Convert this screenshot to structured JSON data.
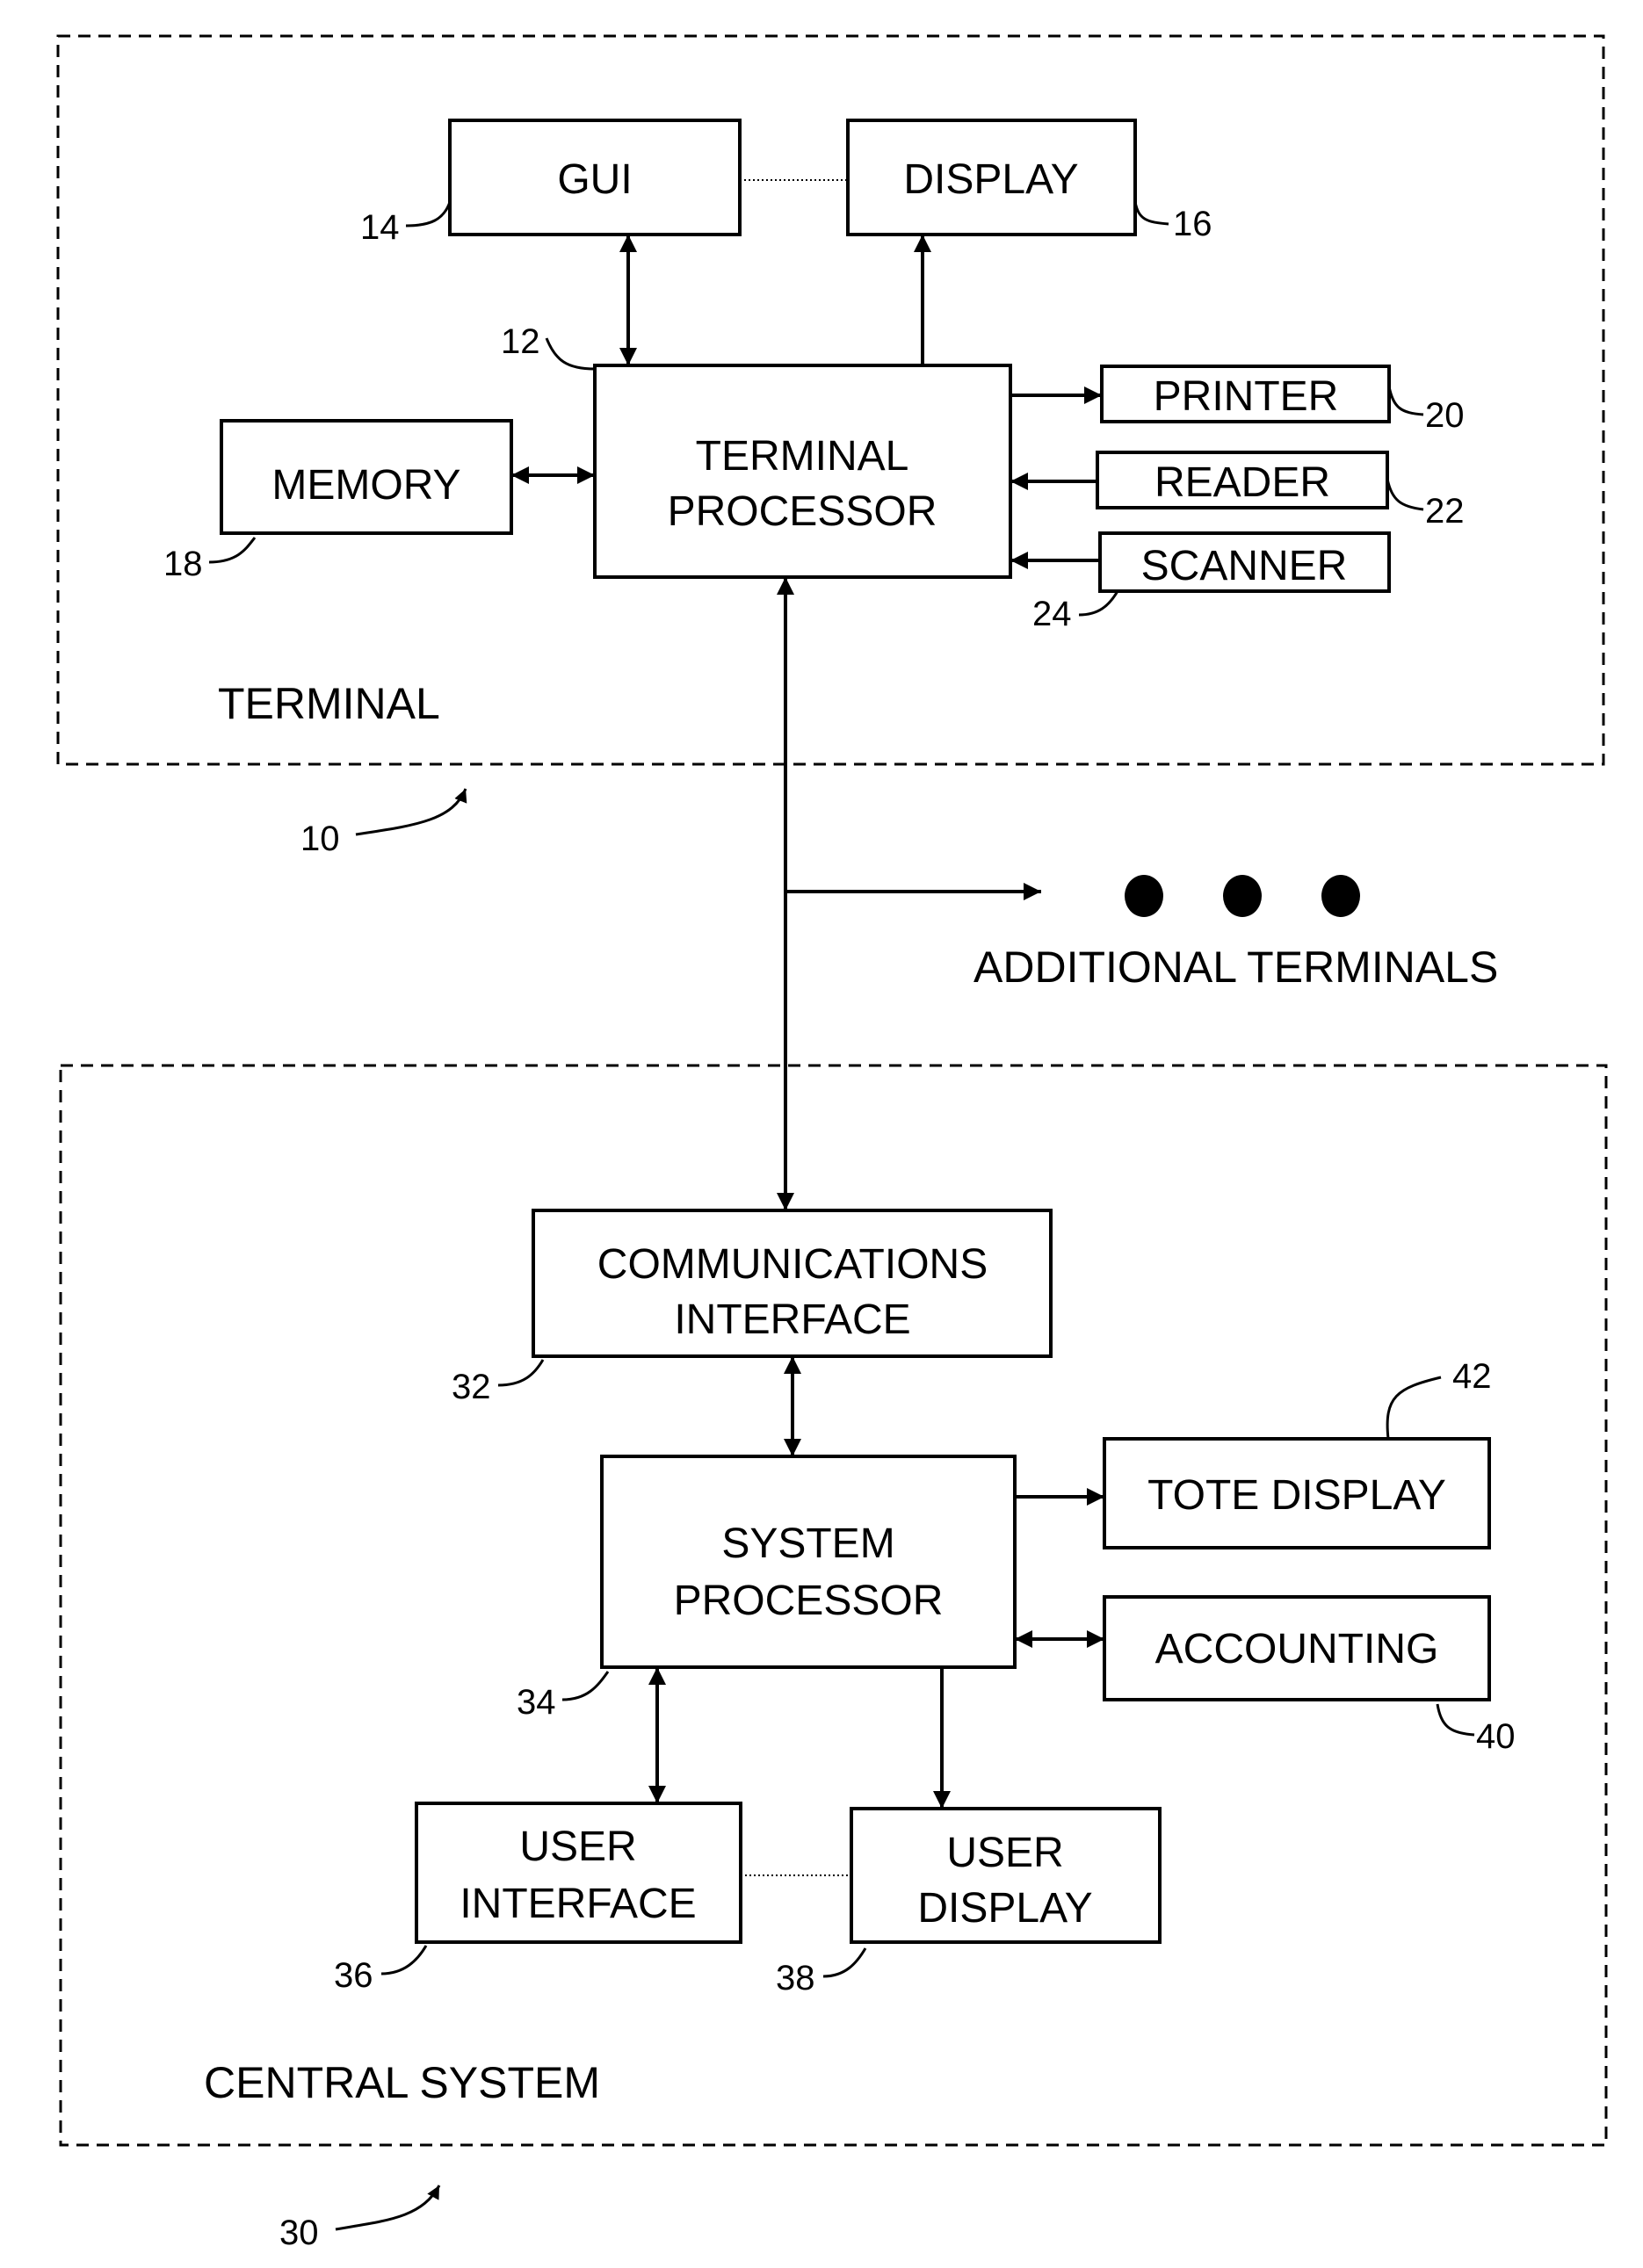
{
  "terminal": {
    "title": "TERMINAL",
    "ref": "10",
    "gui": {
      "label": "GUI",
      "ref": "14"
    },
    "display": {
      "label": "DISPLAY",
      "ref": "16"
    },
    "processor": {
      "line1": "TERMINAL",
      "line2": "PROCESSOR",
      "ref": "12"
    },
    "memory": {
      "label": "MEMORY",
      "ref": "18"
    },
    "printer": {
      "label": "PRINTER",
      "ref": "20"
    },
    "reader": {
      "label": "READER",
      "ref": "22"
    },
    "scanner": {
      "label": "SCANNER",
      "ref": "24"
    }
  },
  "additional_terminals": {
    "label": "ADDITIONAL TERMINALS"
  },
  "central": {
    "title": "CENTRAL SYSTEM",
    "ref": "30",
    "comm": {
      "line1": "COMMUNICATIONS",
      "line2": "INTERFACE",
      "ref": "32"
    },
    "processor": {
      "line1": "SYSTEM",
      "line2": "PROCESSOR",
      "ref": "34"
    },
    "user_interface": {
      "line1": "USER",
      "line2": "INTERFACE",
      "ref": "36"
    },
    "user_display": {
      "line1": "USER",
      "line2": "DISPLAY",
      "ref": "38"
    },
    "accounting": {
      "label": "ACCOUNTING",
      "ref": "40"
    },
    "tote_display": {
      "label": "TOTE DISPLAY",
      "ref": "42"
    }
  }
}
